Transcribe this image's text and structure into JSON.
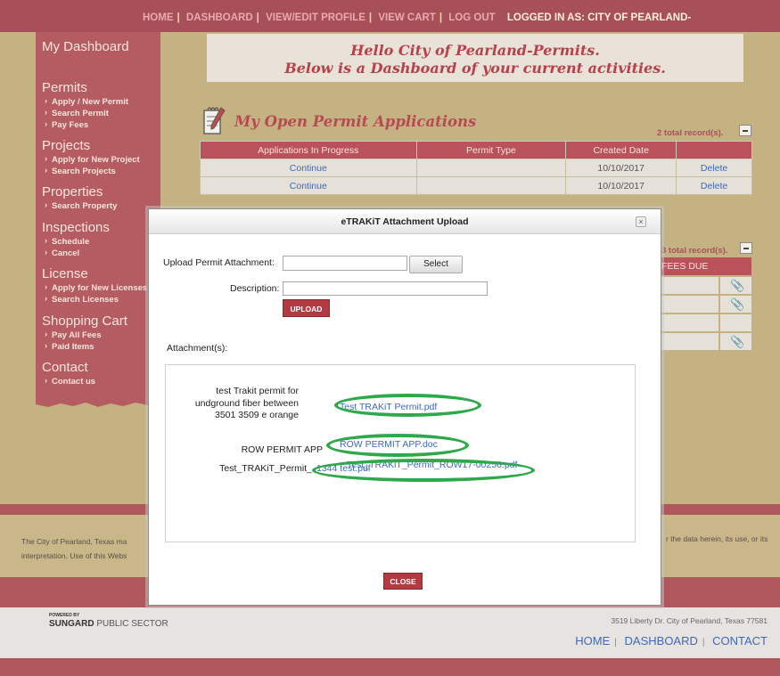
{
  "topnav": {
    "items": [
      "HOME",
      "DASHBOARD",
      "VIEW/EDIT PROFILE",
      "VIEW CART",
      "LOG OUT"
    ],
    "logged_in": "LOGGED IN AS:  CITY OF PEARLAND-"
  },
  "sidebar": {
    "title": "My Dashboard",
    "sections": [
      {
        "label": "Permits",
        "items": [
          "Apply / New Permit",
          "Search Permit",
          "Pay Fees"
        ]
      },
      {
        "label": "Projects",
        "items": [
          "Apply for New Project",
          "Search Projects"
        ]
      },
      {
        "label": "Properties",
        "items": [
          "Search Property"
        ]
      },
      {
        "label": "Inspections",
        "items": [
          "Schedule",
          "Cancel"
        ]
      },
      {
        "label": "License",
        "items": [
          "Apply for New Licenses",
          "Search Licenses"
        ]
      },
      {
        "label": "Shopping Cart",
        "items": [
          "Pay All Fees",
          "Paid Items"
        ]
      },
      {
        "label": "Contact",
        "items": [
          "Contact us"
        ]
      }
    ]
  },
  "greeting": {
    "line1": "Hello City of Pearland-Permits.",
    "line2": "Below is a Dashboard of your current activities."
  },
  "open_permits": {
    "heading": "My Open Permit Applications",
    "record_count": "2 total record(s).",
    "columns": [
      "Applications In Progress",
      "Permit Type",
      "Created Date",
      ""
    ],
    "rows": [
      {
        "action": "Continue",
        "type": "",
        "date": "10/10/2017",
        "delete": "Delete"
      },
      {
        "action": "Continue",
        "type": "",
        "date": "10/10/2017",
        "delete": "Delete"
      }
    ]
  },
  "second_section": {
    "record_count": "3 total record(s).",
    "fees_header": "FEES DUE"
  },
  "footer": {
    "disclaimer_line1": "The City of Pearland, Texas ma",
    "disclaimer_line2": "interpretation. Use of this Webs",
    "disclaimer_right": "r the data herein, its use, or its",
    "powered_by": "POWERED BY",
    "brand": "SUNGARD",
    "brand_suffix": "PUBLIC SECTOR",
    "address": "3519 Liberty Dr. City of Pearland, Texas 77581",
    "nav": [
      "HOME",
      "DASHBOARD",
      "CONTACT"
    ]
  },
  "modal": {
    "title": "eTRAKiT Attachment Upload",
    "upload_label": "Upload Permit Attachment:",
    "select_label": "Select",
    "description_label": "Description:",
    "upload_button": "UPLOAD",
    "attachments_label": "Attachment(s):",
    "attachments": [
      {
        "description": "test Trakit permit for undground fiber between 3501 3509 e orange",
        "file": "Test TRAKiT Permit.pdf"
      },
      {
        "description": "ROW PERMIT APP",
        "file": "ROW PERMIT APP.doc"
      },
      {
        "description": "Test_TRAKiT_Permit_",
        "file": "1344 test.pdf"
      },
      {
        "description": "",
        "file": "Test_TRAKiT_Permit_ROW17-00256.pdf"
      }
    ],
    "close_button": "CLOSE"
  }
}
